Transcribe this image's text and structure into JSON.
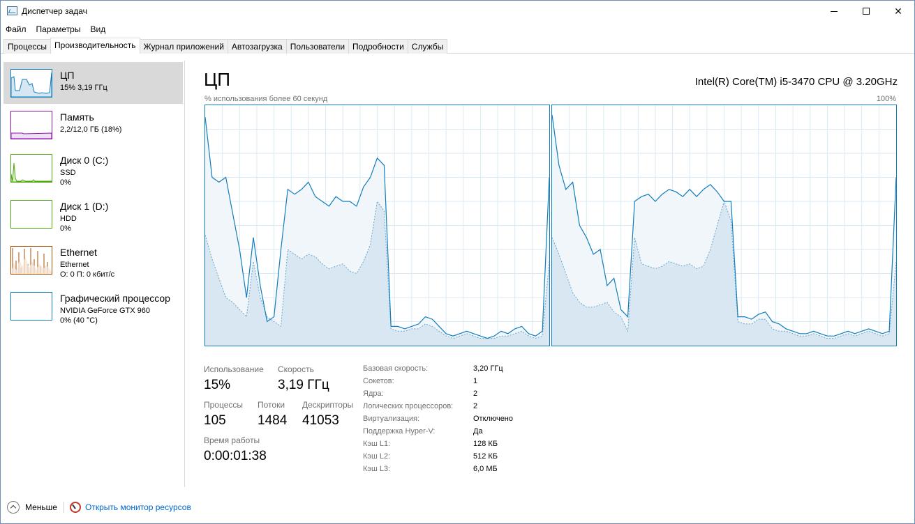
{
  "window": {
    "title": "Диспетчер задач",
    "minimize": "—",
    "maximize": "☐",
    "close": "✕"
  },
  "menu": [
    "Файл",
    "Параметры",
    "Вид"
  ],
  "tabs": [
    "Процессы",
    "Производительность",
    "Журнал приложений",
    "Автозагрузка",
    "Пользователи",
    "Подробности",
    "Службы"
  ],
  "active_tab": "Производительность",
  "sidebar": {
    "items": [
      {
        "title": "ЦП",
        "sub1": "15% 3,19 ГГц",
        "sub2": "",
        "sub3": "",
        "color": "#117dbb",
        "selected": true
      },
      {
        "title": "Память",
        "sub1": "2,2/12,0 ГБ (18%)",
        "sub2": "",
        "sub3": "",
        "color": "#8b12ae"
      },
      {
        "title": "Диск 0 (C:)",
        "sub1": "SSD",
        "sub2": "0%",
        "sub3": "",
        "color": "#4da60c"
      },
      {
        "title": "Диск 1 (D:)",
        "sub1": "HDD",
        "sub2": "0%",
        "sub3": "",
        "color": "#4da60c"
      },
      {
        "title": "Ethernet",
        "sub1": "Ethernet",
        "sub2": "О: 0 П: 0 кбит/с",
        "sub3": "",
        "color": "#a74f01"
      },
      {
        "title": "Графический процессор",
        "sub1": "NVIDIA GeForce GTX 960",
        "sub2": "0% (40 °C)",
        "sub3": "",
        "color": "#117dbb"
      }
    ]
  },
  "main": {
    "title": "ЦП",
    "cpu_model": "Intel(R) Core(TM) i5-3470 CPU @ 3.20GHz",
    "graph_label": "% использования более 60 секунд",
    "graph_max": "100%"
  },
  "stats": {
    "usage_label": "Использование",
    "usage_value": "15%",
    "speed_label": "Скорость",
    "speed_value": "3,19 ГГц",
    "processes_label": "Процессы",
    "processes_value": "105",
    "threads_label": "Потоки",
    "threads_value": "1484",
    "handles_label": "Дескрипторы",
    "handles_value": "41053",
    "uptime_label": "Время работы",
    "uptime_value": "0:00:01:38"
  },
  "specs": [
    {
      "label": "Базовая скорость:",
      "value": "3,20 ГГц"
    },
    {
      "label": "Сокетов:",
      "value": "1"
    },
    {
      "label": "Ядра:",
      "value": "2"
    },
    {
      "label": "Логических процессоров:",
      "value": "2"
    },
    {
      "label": "Виртуализация:",
      "value": "Отключено"
    },
    {
      "label": "Поддержка Hyper-V:",
      "value": "Да"
    },
    {
      "label": "Кэш L1:",
      "value": "128 КБ"
    },
    {
      "label": "Кэш L2:",
      "value": "512 КБ"
    },
    {
      "label": "Кэш L3:",
      "value": "6,0 МБ"
    }
  ],
  "footer": {
    "fewer": "Меньше",
    "resource_monitor": "Открыть монитор ресурсов"
  },
  "chart_data": {
    "type": "area",
    "ylim": [
      0,
      100
    ],
    "grid": true,
    "series": [
      {
        "values": [
          95,
          70,
          68,
          70,
          55,
          40,
          20,
          45,
          25,
          10,
          12,
          40,
          65,
          63,
          65,
          68,
          62,
          60,
          58,
          62,
          60,
          60,
          58,
          66,
          70,
          78,
          75,
          8,
          8,
          7,
          8,
          9,
          12,
          11,
          8,
          5,
          4,
          5,
          6,
          5,
          4,
          3,
          4,
          6,
          5,
          7,
          8,
          5,
          4,
          6,
          70
        ]
      },
      {
        "values": [
          46,
          36,
          28,
          20,
          18,
          15,
          12,
          35,
          20,
          12,
          10,
          8,
          40,
          38,
          36,
          38,
          37,
          34,
          32,
          33,
          34,
          31,
          30,
          35,
          42,
          60,
          56,
          7,
          6,
          6,
          7,
          7,
          9,
          8,
          6,
          4,
          3,
          4,
          5,
          4,
          3,
          3,
          3,
          4,
          4,
          5,
          6,
          4,
          3,
          4,
          35
        ]
      },
      {
        "values": [
          96,
          75,
          65,
          68,
          50,
          45,
          38,
          40,
          25,
          28,
          15,
          12,
          60,
          62,
          63,
          60,
          63,
          65,
          64,
          62,
          65,
          62,
          65,
          67,
          64,
          60,
          60,
          12,
          12,
          11,
          13,
          14,
          10,
          9,
          7,
          6,
          5,
          5,
          6,
          5,
          4,
          4,
          5,
          6,
          5,
          6,
          7,
          6,
          5,
          6,
          70
        ]
      },
      {
        "values": [
          45,
          38,
          30,
          22,
          18,
          16,
          16,
          17,
          18,
          14,
          12,
          6,
          45,
          34,
          33,
          32,
          33,
          35,
          34,
          33,
          34,
          32,
          33,
          40,
          50,
          60,
          52,
          10,
          9,
          9,
          11,
          11,
          7,
          6,
          6,
          5,
          4,
          4,
          5,
          4,
          3,
          3,
          4,
          5,
          4,
          5,
          6,
          5,
          4,
          5,
          35
        ]
      }
    ]
  }
}
